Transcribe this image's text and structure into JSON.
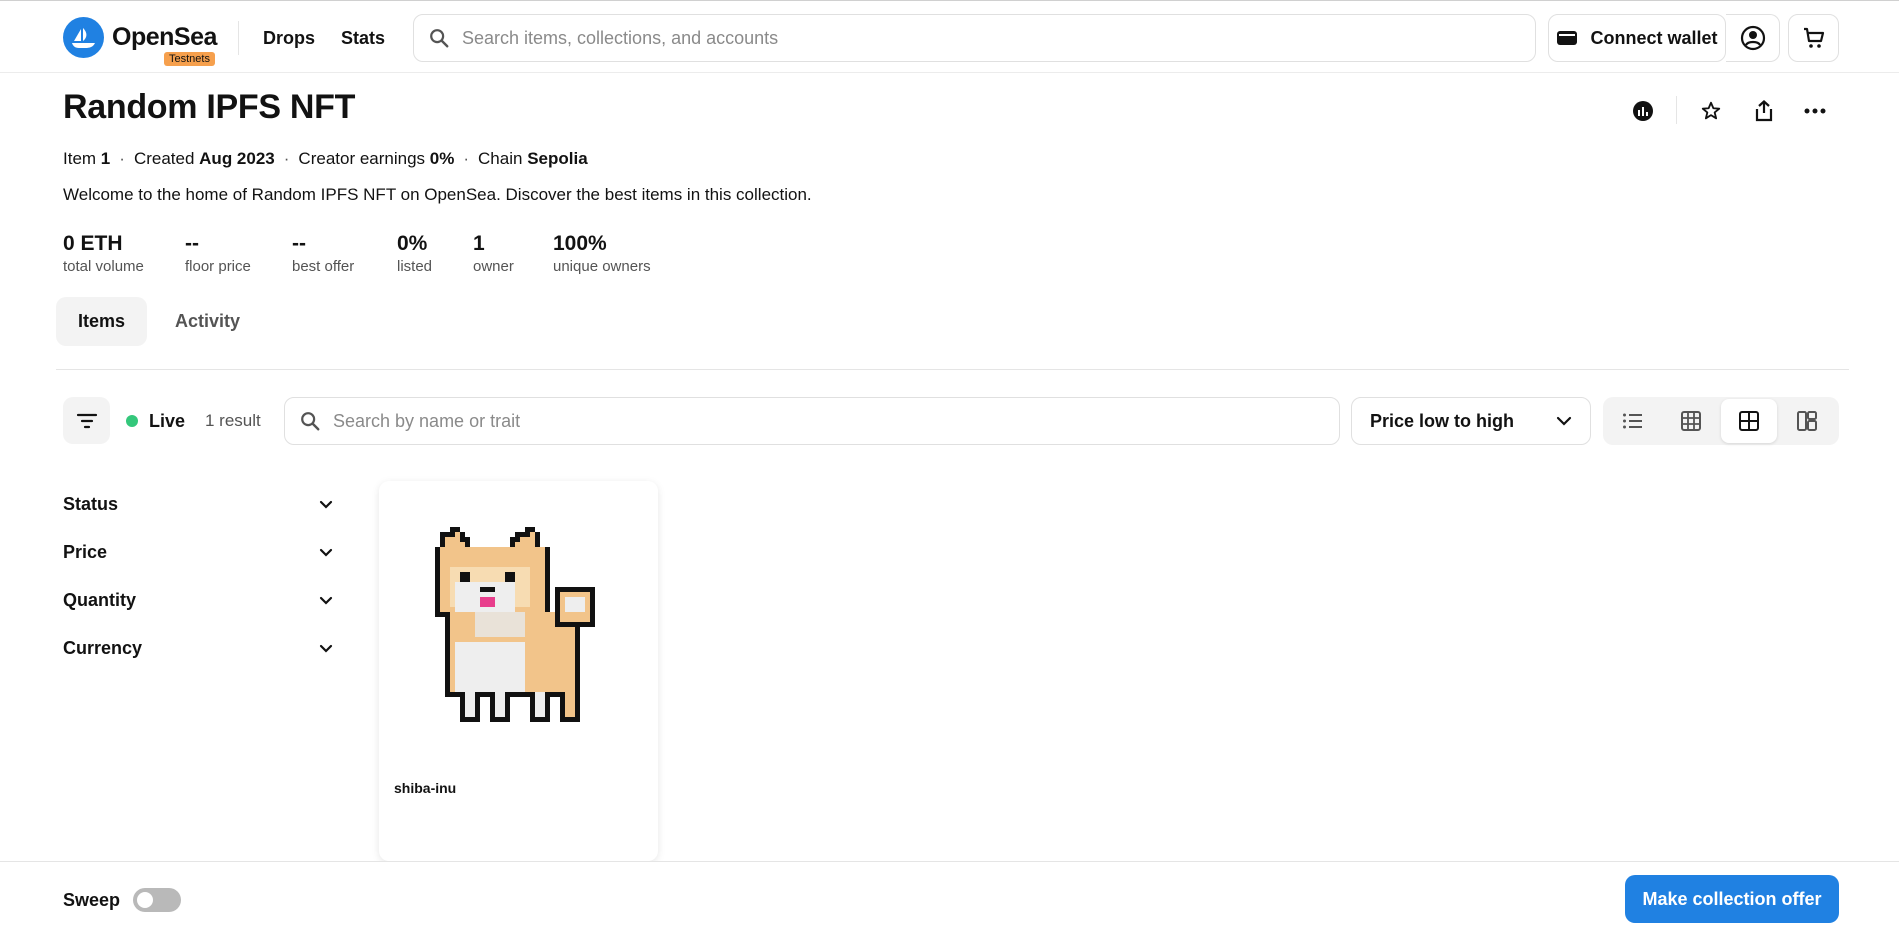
{
  "header": {
    "logo_text": "OpenSea",
    "badge": "Testnets",
    "nav": [
      "Drops",
      "Stats"
    ],
    "search_placeholder": "Search items, collections, and accounts",
    "connect_wallet": "Connect wallet"
  },
  "collection": {
    "title": "Random IPFS NFT",
    "meta": {
      "item_label": "Item",
      "item_value": "1",
      "created_label": "Created",
      "created_value": "Aug 2023",
      "earnings_label": "Creator earnings",
      "earnings_value": "0%",
      "chain_label": "Chain",
      "chain_value": "Sepolia"
    },
    "description": "Welcome to the home of Random IPFS NFT on OpenSea. Discover the best items in this collection.",
    "stats": [
      {
        "value": "0 ETH",
        "label": "total volume"
      },
      {
        "value": "--",
        "label": "floor price"
      },
      {
        "value": "--",
        "label": "best offer"
      },
      {
        "value": "0%",
        "label": "listed"
      },
      {
        "value": "1",
        "label": "owner"
      },
      {
        "value": "100%",
        "label": "unique owners"
      }
    ]
  },
  "tabs": [
    "Items",
    "Activity"
  ],
  "toolbar": {
    "live": "Live",
    "results": "1 result",
    "search_placeholder": "Search by name or trait",
    "sort": "Price low to high"
  },
  "filters": [
    "Status",
    "Price",
    "Quantity",
    "Currency"
  ],
  "items": [
    {
      "name": "shiba-inu"
    }
  ],
  "footer": {
    "sweep": "Sweep",
    "offer_button": "Make collection offer"
  },
  "colors": {
    "accent": "#2081e2",
    "live": "#34c77b",
    "badge": "#f6a04d"
  }
}
